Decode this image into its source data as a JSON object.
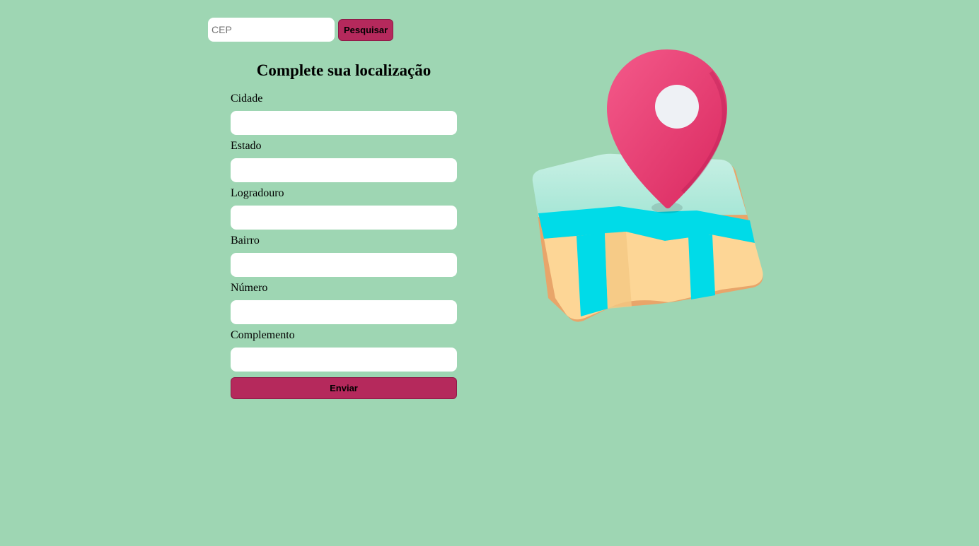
{
  "search": {
    "placeholder": "CEP",
    "button_label": "Pesquisar"
  },
  "form": {
    "title": "Complete sua localização",
    "fields": [
      {
        "label": "Cidade"
      },
      {
        "label": "Estado"
      },
      {
        "label": "Logradouro"
      },
      {
        "label": "Bairro"
      },
      {
        "label": "Número"
      },
      {
        "label": "Complemento"
      }
    ],
    "submit_label": "Enviar"
  },
  "colors": {
    "background": "#9ed6b3",
    "accent": "#b5295c",
    "input_background": "#ffffff"
  },
  "illustration": {
    "icon": "map-pin-icon"
  }
}
